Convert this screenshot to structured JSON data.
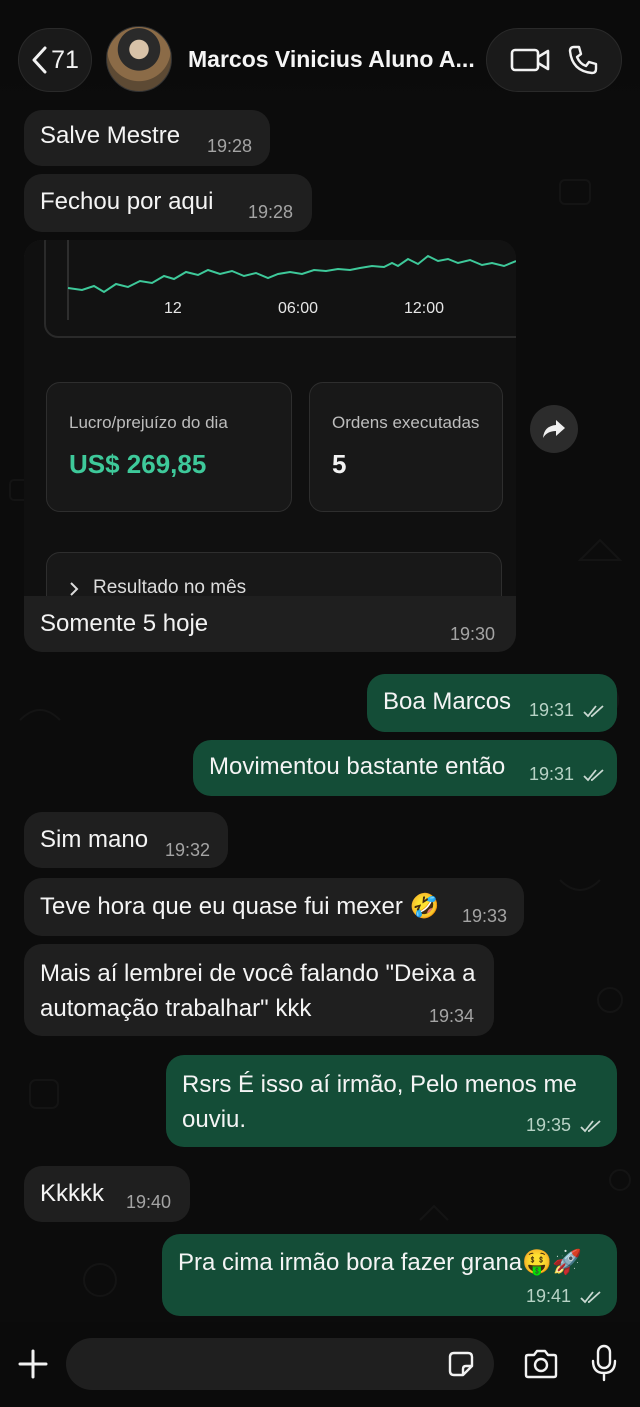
{
  "header": {
    "unread_count": "71",
    "contact_name": "Marcos Vinicius Aluno A..."
  },
  "messages": [
    {
      "text": "Salve Mestre",
      "time": "19:28",
      "dir": "in"
    },
    {
      "text": "Fechou por aqui",
      "time": "19:28",
      "dir": "in"
    },
    {
      "text": "Somente 5 hoje",
      "time": "19:30",
      "dir": "in"
    },
    {
      "text": "Boa Marcos",
      "time": "19:31",
      "dir": "out"
    },
    {
      "text": "Movimentou bastante então",
      "time": "19:31",
      "dir": "out"
    },
    {
      "text": "Sim mano",
      "time": "19:32",
      "dir": "in"
    },
    {
      "text": "Teve hora que eu quase fui mexer 🤣",
      "time": "19:33",
      "dir": "in"
    },
    {
      "line1": "Mais aí lembrei de você falando \"Deixa a",
      "line2": "automação trabalhar\" kkk",
      "time": "19:34",
      "dir": "in"
    },
    {
      "line1": "Rsrs É isso aí irmão, Pelo menos me",
      "line2": "ouviu.",
      "time": "19:35",
      "dir": "out"
    },
    {
      "text": "Kkkkk",
      "time": "19:40",
      "dir": "in"
    },
    {
      "text": "Pra cima irmão bora fazer grana🤑🚀",
      "time": "19:41",
      "dir": "out"
    }
  ],
  "shared_screenshot": {
    "chart_ticks": [
      "12",
      "06:00",
      "12:00"
    ],
    "profit_label": "Lucro/prejuízo do dia",
    "profit_value": "US$ 269,85",
    "orders_label": "Ordens executadas",
    "orders_value": "5",
    "month_label": "Resultado no mês",
    "accent": "#3ec99a"
  },
  "composer": {
    "placeholder": ""
  }
}
